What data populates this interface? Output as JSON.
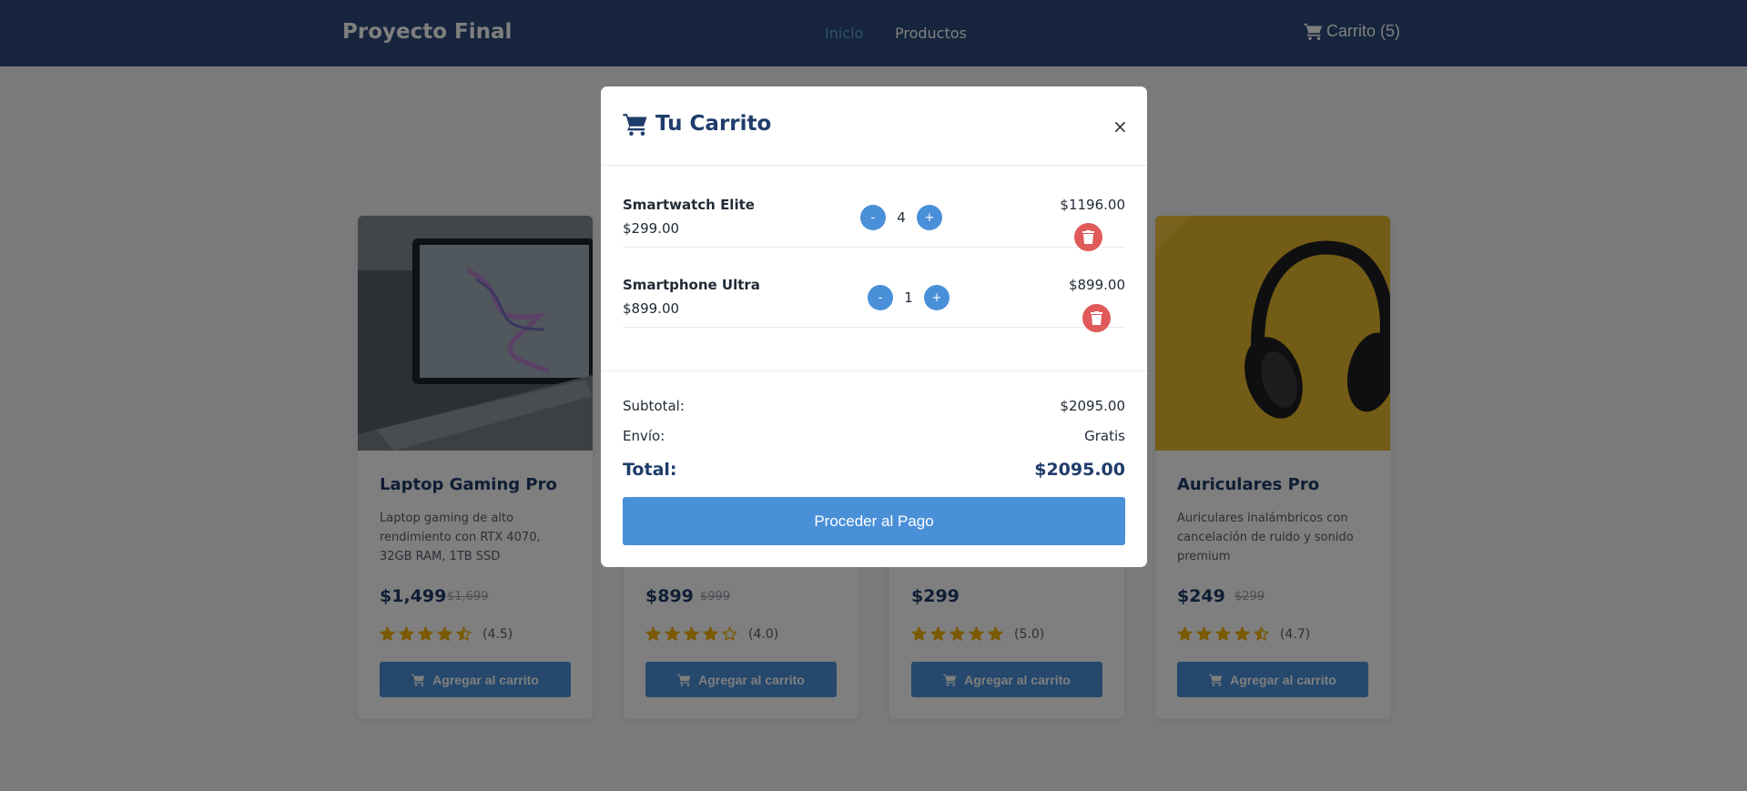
{
  "navbar": {
    "brand": "Proyecto Final",
    "links": [
      {
        "label": "Inicio",
        "active": true
      },
      {
        "label": "Productos",
        "active": false
      }
    ],
    "cart_label": "Carrito (5)"
  },
  "products": [
    {
      "title": "Laptop Gaming Pro",
      "desc": "Laptop gaming de alto rendimiento con RTX 4070, 32GB RAM, 1TB SSD",
      "price": "$1,499",
      "old_price": "$1,699",
      "rating": "(4.5)",
      "stars": 4.5,
      "button": "Agregar al carrito"
    },
    {
      "title": "",
      "desc": "",
      "price": "$899",
      "old_price": "$999",
      "rating": "(4.0)",
      "stars": 4.0,
      "button": "Agregar al carrito"
    },
    {
      "title": "",
      "desc": "",
      "price": "$299",
      "old_price": "",
      "rating": "(5.0)",
      "stars": 5.0,
      "button": "Agregar al carrito"
    },
    {
      "title": "Auriculares Pro",
      "desc": "Auriculares inalámbricos con cancelación de ruido y sonido premium",
      "price": "$249",
      "old_price": "$299",
      "rating": "(4.7)",
      "stars": 4.5,
      "button": "Agregar al carrito"
    }
  ],
  "modal": {
    "title": "Tu Carrito",
    "close": "×",
    "items": [
      {
        "name": "Smartwatch Elite",
        "unit_price": "$299.00",
        "qty": "4",
        "total": "$1196.00",
        "minus": "-",
        "plus": "+"
      },
      {
        "name": "Smartphone Ultra",
        "unit_price": "$899.00",
        "qty": "1",
        "total": "$899.00",
        "minus": "-",
        "plus": "+"
      }
    ],
    "summary": {
      "subtotal_label": "Subtotal:",
      "subtotal_value": "$2095.00",
      "shipping_label": "Envío:",
      "shipping_value": "Gratis",
      "total_label": "Total:",
      "total_value": "$2095.00"
    },
    "pay_button": "Proceder al Pago"
  },
  "colors": {
    "navbar": "#2c4a7a",
    "accent": "#4a90d9",
    "danger": "#e05a5a",
    "star": "#f5b301",
    "heading": "#1f3c6b"
  }
}
